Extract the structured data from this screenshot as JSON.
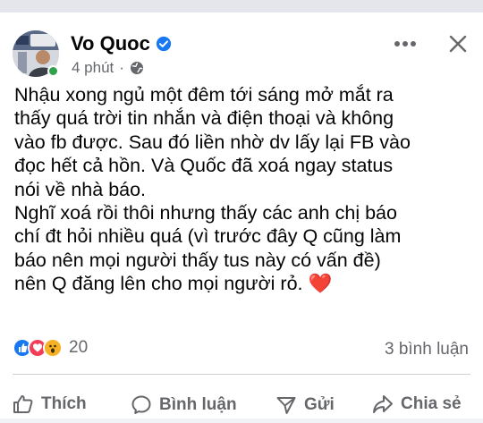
{
  "post": {
    "author": "Vo Quoc",
    "time": "4 phút",
    "separator": "·",
    "text": "Nhậu xong ngủ một đêm tới sáng mở mắt ra\nthấy quá trời tin nhắn và điện thoại và không\nvào fb được. Sau đó liền nhờ dv lấy lại FB vào\nđọc hết cả hồn. Và Quốc đã xoá ngay status\nnói về nhà báo.\nNghĩ xoá rồi thôi nhưng thấy các anh chị báo\nchí đt hỏi nhiều quá (vì trước đây Q cũng làm\nbáo nên mọi người thấy tus này có vấn đề)\nnên Q đăng lên cho mọi người rỏ.",
    "heart_emoji": "❤️"
  },
  "stats": {
    "reactions_count": "20",
    "comments": "3 bình luận"
  },
  "actions": {
    "like": "Thích",
    "comment": "Bình luận",
    "send": "Gửi",
    "share": "Chia sẻ"
  },
  "icons": {
    "verified": "verified-badge-icon",
    "privacy": "globe-icon",
    "more": "more-options-icon",
    "close": "close-icon"
  },
  "colors": {
    "verified_blue": "#1877f2",
    "secondary_text": "#65676b",
    "heart_red": "#e41e3f",
    "online_green": "#31a24c"
  }
}
